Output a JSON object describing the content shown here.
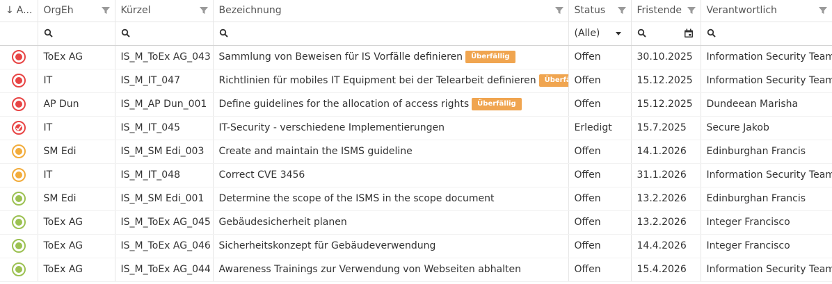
{
  "columns": [
    {
      "key": "status_icon",
      "label": "A...",
      "sort_indicator": "↓"
    },
    {
      "key": "orgeh",
      "label": "OrgEh"
    },
    {
      "key": "kuerzel",
      "label": "Kürzel"
    },
    {
      "key": "bezeichnung",
      "label": "Bezeichnung"
    },
    {
      "key": "status",
      "label": "Status"
    },
    {
      "key": "fristende",
      "label": "Fristende"
    },
    {
      "key": "verantwortlich",
      "label": "Verantwortlich"
    }
  ],
  "filter": {
    "status_value": "(Alle)"
  },
  "overdue_badge": "Überfällig",
  "colors": {
    "red": "#e84545",
    "orange": "#f2ac3c",
    "green": "#9cc152",
    "badge": "#f0a550"
  },
  "rows": [
    {
      "indicator": "red",
      "indicator_icon": "red-circle-icon",
      "orgeh": "ToEx AG",
      "kuerzel": "IS_M_ToEx AG_043",
      "bezeichnung": "Sammlung von Beweisen für IS Vorfälle definieren",
      "overdue": true,
      "status": "Offen",
      "fristende": "30.10.2025",
      "verantwortlich": "Information Security Team"
    },
    {
      "indicator": "red",
      "indicator_icon": "red-circle-icon",
      "orgeh": "IT",
      "kuerzel": "IS_M_IT_047",
      "bezeichnung": "Richtlinien für mobiles IT Equipment bei der Telearbeit definieren",
      "overdue": true,
      "status": "Offen",
      "fristende": "15.12.2025",
      "verantwortlich": "Information Security Team"
    },
    {
      "indicator": "red",
      "indicator_icon": "red-circle-icon",
      "orgeh": "AP Dun",
      "kuerzel": "IS_M_AP Dun_001",
      "bezeichnung": "Define guidelines for the allocation of access rights",
      "overdue": true,
      "status": "Offen",
      "fristende": "15.12.2025",
      "verantwortlich": "Dundeean Marisha"
    },
    {
      "indicator": "red-check",
      "indicator_icon": "red-check-circle-icon",
      "orgeh": "IT",
      "kuerzel": "IS_M_IT_045",
      "bezeichnung": "IT-Security - verschiedene Implementierungen",
      "overdue": false,
      "status": "Erledigt",
      "fristende": "15.7.2025",
      "verantwortlich": "Secure Jakob"
    },
    {
      "indicator": "orange",
      "indicator_icon": "orange-circle-icon",
      "orgeh": "SM Edi",
      "kuerzel": "IS_M_SM Edi_003",
      "bezeichnung": "Create and maintain the ISMS guideline",
      "overdue": false,
      "status": "Offen",
      "fristende": "14.1.2026",
      "verantwortlich": "Edinburghan Francis"
    },
    {
      "indicator": "orange",
      "indicator_icon": "orange-circle-icon",
      "orgeh": "IT",
      "kuerzel": "IS_M_IT_048",
      "bezeichnung": "Correct CVE 3456",
      "overdue": false,
      "status": "Offen",
      "fristende": "31.1.2026",
      "verantwortlich": "Information Security Team"
    },
    {
      "indicator": "green",
      "indicator_icon": "green-circle-icon",
      "orgeh": "SM Edi",
      "kuerzel": "IS_M_SM Edi_001",
      "bezeichnung": "Determine the scope of the ISMS in the scope document",
      "overdue": false,
      "status": "Offen",
      "fristende": "13.2.2026",
      "verantwortlich": "Edinburghan Francis"
    },
    {
      "indicator": "green",
      "indicator_icon": "green-circle-icon",
      "orgeh": "ToEx AG",
      "kuerzel": "IS_M_ToEx AG_045",
      "bezeichnung": "Gebäudesicherheit planen",
      "overdue": false,
      "status": "Offen",
      "fristende": "13.2.2026",
      "verantwortlich": "Integer Francisco"
    },
    {
      "indicator": "green",
      "indicator_icon": "green-circle-icon",
      "orgeh": "ToEx AG",
      "kuerzel": "IS_M_ToEx AG_046",
      "bezeichnung": "Sicherheitskonzept für Gebäudeverwendung",
      "overdue": false,
      "status": "Offen",
      "fristende": "14.4.2026",
      "verantwortlich": "Integer Francisco"
    },
    {
      "indicator": "green",
      "indicator_icon": "green-circle-icon",
      "orgeh": "ToEx AG",
      "kuerzel": "IS_M_ToEx AG_044",
      "bezeichnung": "Awareness Trainings zur Verwendung von Webseiten abhalten",
      "overdue": false,
      "status": "Offen",
      "fristende": "15.4.2026",
      "verantwortlich": "Information Security Team"
    }
  ]
}
